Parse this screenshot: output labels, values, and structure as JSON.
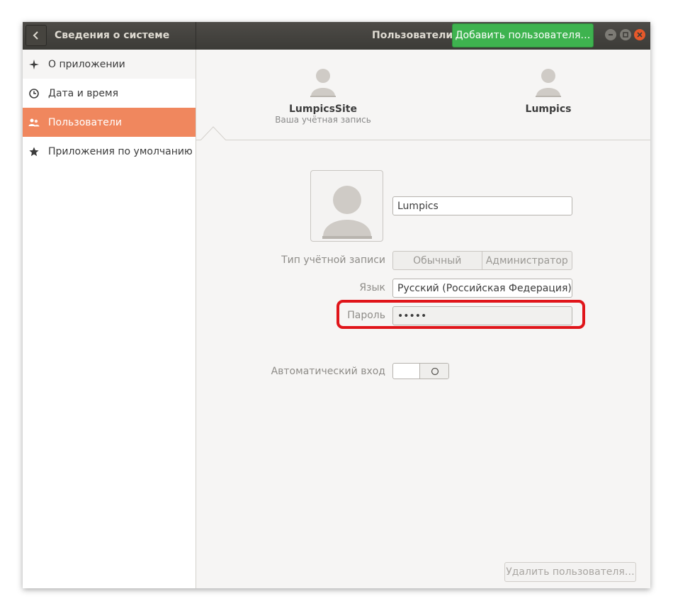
{
  "titlebar": {
    "app_title": "Сведения о системе",
    "section_title": "Пользователи",
    "add_user_label": "Добавить пользователя…",
    "accent_color": "#3eb34f"
  },
  "sidebar": {
    "items": [
      {
        "label": "О приложении",
        "icon": "sparkle-icon"
      },
      {
        "label": "Дата и время",
        "icon": "clock-icon"
      },
      {
        "label": "Пользователи",
        "icon": "users-icon",
        "active": true
      },
      {
        "label": "Приложения по умолчанию",
        "icon": "star-icon"
      }
    ],
    "active_color": "#f0875e"
  },
  "users": [
    {
      "name": "LumpicsSite",
      "subtitle": "Ваша учётная запись"
    },
    {
      "name": "Lumpics"
    }
  ],
  "details": {
    "username": "Lumpics",
    "account_type_label": "Тип учётной записи",
    "account_type_options": [
      "Обычный",
      "Администратор"
    ],
    "language_label": "Язык",
    "language_value": "Русский (Российская Федерация)",
    "password_label": "Пароль",
    "password_value": "•••••",
    "autologin_label": "Автоматический вход",
    "autologin_enabled": false,
    "highlight_color": "#e0151a"
  },
  "footer": {
    "delete_user_label": "Удалить пользователя…"
  }
}
